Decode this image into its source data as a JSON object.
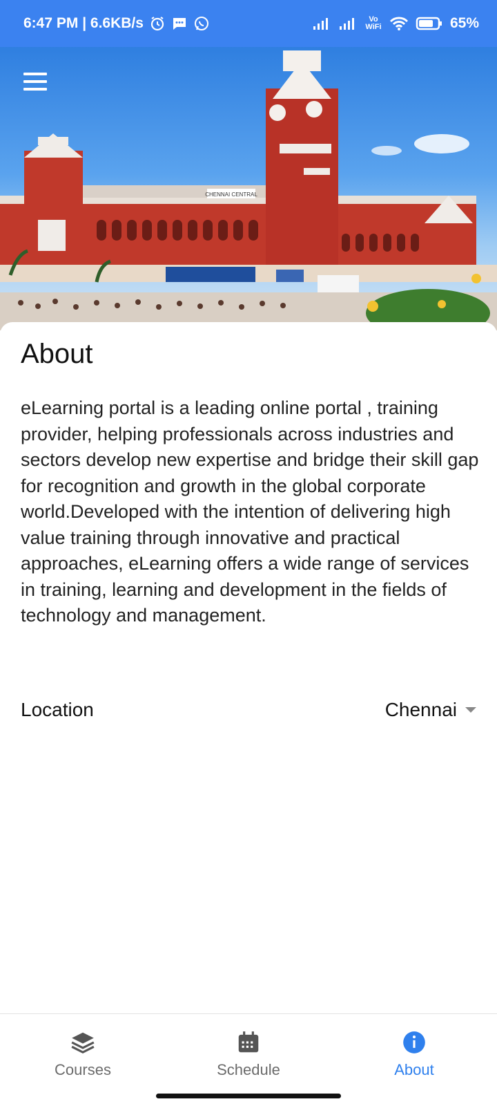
{
  "status_bar": {
    "time_speed": "6:47 PM | 6.6KB/s",
    "vowifi": "Vo WiFi",
    "battery": "65%"
  },
  "hero": {
    "sign_text": "CHENNAI CENTRAL"
  },
  "about": {
    "title": "About",
    "description": "eLearning portal is a leading online portal , training provider, helping professionals across industries and sectors develop new expertise and bridge their skill gap for recognition and growth in the global corporate world.Developed with the intention of delivering high value training through innovative and practical approaches, eLearning offers a wide range of services in training, learning and development in the fields of technology and management."
  },
  "location": {
    "label": "Location",
    "value": "Chennai"
  },
  "nav": {
    "courses": "Courses",
    "schedule": "Schedule",
    "about": "About"
  },
  "colors": {
    "status_bar": "#3b82f0",
    "accent": "#2f80ed",
    "inactive": "#6b6b6b"
  }
}
